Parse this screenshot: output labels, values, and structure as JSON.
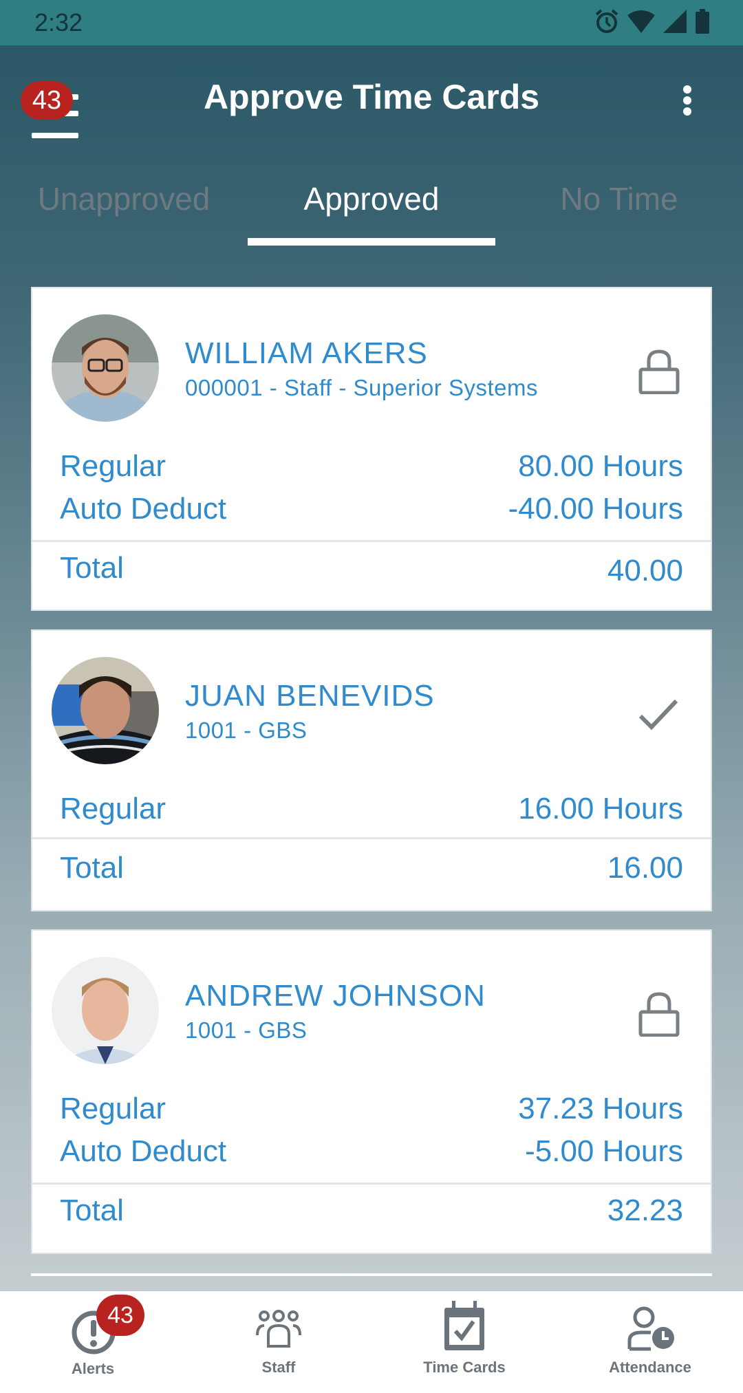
{
  "status_bar": {
    "time": "2:32",
    "icons": [
      "alarm-icon",
      "wifi-icon",
      "signal-icon",
      "battery-icon"
    ]
  },
  "header": {
    "title": "Approve Time Cards",
    "menu_badge": "43",
    "menu_icon": "hamburger-icon",
    "overflow_icon": "more-vertical-icon"
  },
  "tabs": [
    {
      "label": "Unapproved",
      "active": false
    },
    {
      "label": "Approved",
      "active": true
    },
    {
      "label": "No Time",
      "active": false
    }
  ],
  "colors": {
    "accent_text": "#2f8bcd",
    "badge": "#b8231f",
    "status_bar": "#2f7f82",
    "icon_gray": "#6b737b"
  },
  "cards": [
    {
      "name": "WILLIAM AKERS",
      "subtitle": "000001 - Staff - Superior Systems",
      "status_icon": "lock-icon",
      "rows": [
        {
          "label": "Regular",
          "value": "80.00 Hours"
        },
        {
          "label": "Auto Deduct",
          "value": "-40.00 Hours"
        }
      ],
      "total_label": "Total",
      "total_value": "40.00"
    },
    {
      "name": "JUAN BENEVIDS",
      "subtitle": "1001 - GBS",
      "status_icon": "check-icon",
      "rows": [
        {
          "label": "Regular",
          "value": "16.00 Hours"
        }
      ],
      "total_label": "Total",
      "total_value": "16.00"
    },
    {
      "name": "ANDREW JOHNSON",
      "subtitle": "1001 - GBS",
      "status_icon": "lock-icon",
      "rows": [
        {
          "label": "Regular",
          "value": "37.23 Hours"
        },
        {
          "label": "Auto Deduct",
          "value": "-5.00 Hours"
        }
      ],
      "total_label": "Total",
      "total_value": "32.23"
    }
  ],
  "bottom_nav": [
    {
      "label": "Alerts",
      "icon": "alert-icon",
      "badge": "43"
    },
    {
      "label": "Staff",
      "icon": "staff-group-icon"
    },
    {
      "label": "Time Cards",
      "icon": "calendar-check-icon"
    },
    {
      "label": "Attendance",
      "icon": "person-clock-icon"
    }
  ]
}
